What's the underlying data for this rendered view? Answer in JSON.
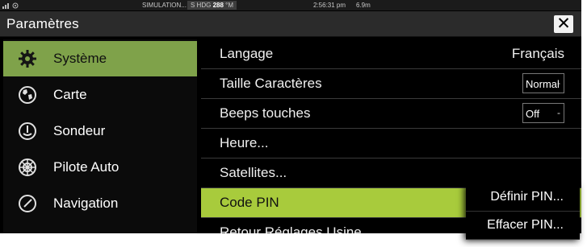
{
  "status_bar": {
    "simulation": "SIMULATION...",
    "hdg_prefix": "S HDG",
    "hdg_value": "288",
    "hdg_unit": "°M",
    "time": "2:56:31 pm",
    "range": "6.9m"
  },
  "window": {
    "title": "Paramètres",
    "close_glyph": "✕"
  },
  "sidebar": {
    "items": [
      {
        "label": "Système",
        "icon": "gear-icon",
        "active": true
      },
      {
        "label": "Carte",
        "icon": "globe-icon",
        "active": false
      },
      {
        "label": "Sondeur",
        "icon": "sonar-icon",
        "active": false
      },
      {
        "label": "Pilote Auto",
        "icon": "helm-icon",
        "active": false
      },
      {
        "label": "Navigation",
        "icon": "compass-icon",
        "active": false
      }
    ]
  },
  "settings": {
    "rows": [
      {
        "label": "Langage",
        "value": "Français"
      },
      {
        "label": "Taille Caractères",
        "dropdown": "Normal"
      },
      {
        "label": "Beeps touches",
        "dropdown": "Off"
      },
      {
        "label": "Heure..."
      },
      {
        "label": "Satellites..."
      },
      {
        "label": "Code PIN",
        "active": true
      },
      {
        "label": "Retour Réglages Usine..."
      }
    ],
    "dropdown_arrow": "-"
  },
  "popup_menu": {
    "items": [
      "Définir PIN...",
      "Effacer PIN..."
    ]
  },
  "colors": {
    "sidebar_active": "#7fa24a",
    "row_active": "#a8cb3c",
    "background": "#000000"
  }
}
